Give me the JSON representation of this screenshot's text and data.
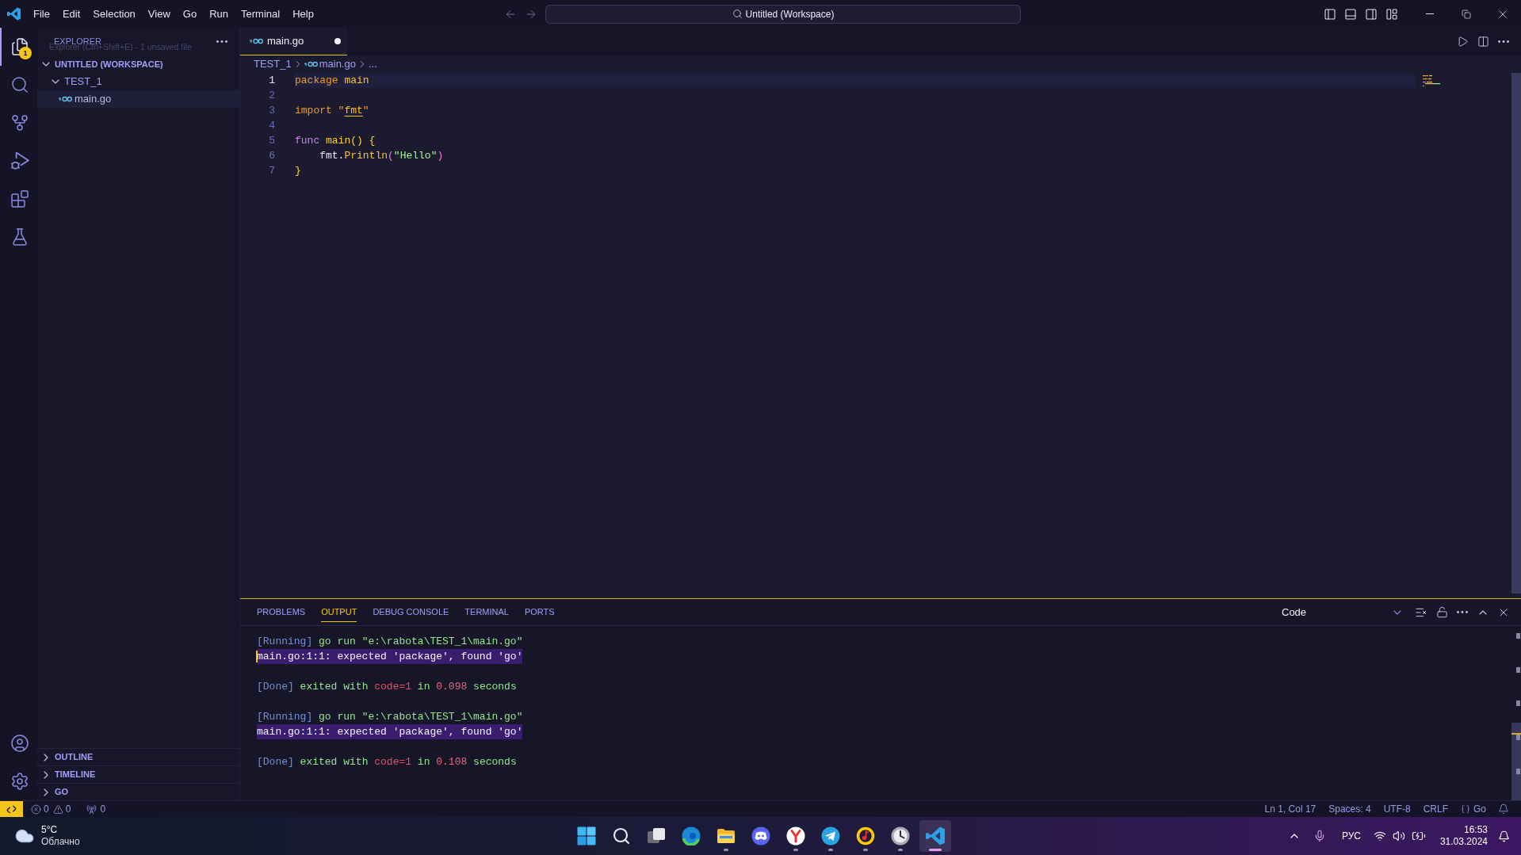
{
  "title_bar": {
    "menu": [
      "File",
      "Edit",
      "Selection",
      "View",
      "Go",
      "Run",
      "Terminal",
      "Help"
    ],
    "command_center": "Untitled (Workspace)"
  },
  "activity_bar": {
    "items": [
      {
        "kind": "explorer",
        "selected": true,
        "badge": "1"
      },
      {
        "kind": "search",
        "selected": false
      },
      {
        "kind": "source_control",
        "selected": false
      },
      {
        "kind": "run_debug",
        "selected": false
      },
      {
        "kind": "extensions",
        "selected": false
      },
      {
        "kind": "testing",
        "selected": false
      }
    ],
    "bottom_items": [
      {
        "kind": "accounts"
      },
      {
        "kind": "settings"
      }
    ]
  },
  "sidebar": {
    "title": "EXPLORER",
    "tooltip": "Explorer (Ctrl+Shift+E) - 1 unsaved file",
    "tree": [
      {
        "label": "UNTITLED (WORKSPACE)",
        "kind": "section",
        "expanded": true,
        "selected": false,
        "children": [
          {
            "label": "TEST_1",
            "kind": "folder",
            "expanded": true,
            "selected": false,
            "children": [
              {
                "label": "main.go",
                "kind": "file",
                "selected": true
              }
            ]
          }
        ]
      }
    ],
    "sections": [
      {
        "label": "OUTLINE",
        "expanded": false
      },
      {
        "label": "TIMELINE",
        "expanded": false
      },
      {
        "label": "GO",
        "expanded": false
      }
    ]
  },
  "editor": {
    "tabs": [
      {
        "label": "main.go",
        "selected": true,
        "dirty": true
      }
    ],
    "breadcrumbs": [
      {
        "label": "TEST_1",
        "kind": "folder"
      },
      {
        "label": "main.go",
        "kind": "file"
      },
      {
        "label": "...",
        "kind": "symbol"
      }
    ],
    "lines": [
      {
        "number": "1",
        "current": true,
        "tokens": [
          {
            "text": "package ",
            "kind": "keyword"
          },
          {
            "text": "main",
            "kind": "name"
          }
        ]
      },
      {
        "number": "2",
        "current": false
      },
      {
        "number": "3",
        "current": false,
        "tokens": [
          {
            "text": "import \"",
            "kind": "keyword"
          },
          {
            "text": "fmt",
            "kind": "link"
          },
          {
            "text": "\"",
            "kind": "keyword"
          }
        ]
      },
      {
        "number": "4",
        "current": false
      },
      {
        "number": "5",
        "current": false,
        "tokens": [
          {
            "text": "func ",
            "kind": "storage"
          },
          {
            "text": "main() {",
            "kind": "function"
          }
        ]
      },
      {
        "number": "6",
        "current": false,
        "tokens": [
          {
            "text": "    fmt.",
            "kind": "variable"
          },
          {
            "text": "Println",
            "kind": "method"
          },
          {
            "text": "(",
            "kind": "paren"
          },
          {
            "text": "\"Hello\"",
            "kind": "string"
          },
          {
            "text": ")",
            "kind": "paren"
          }
        ]
      },
      {
        "number": "7",
        "current": false,
        "tokens": [
          {
            "text": "}",
            "kind": "function"
          }
        ]
      }
    ]
  },
  "panel": {
    "tabs": [
      {
        "label": "PROBLEMS",
        "selected": false
      },
      {
        "label": "OUTPUT",
        "selected": true
      },
      {
        "label": "DEBUG CONSOLE",
        "selected": false
      },
      {
        "label": "TERMINAL",
        "selected": false
      },
      {
        "label": "PORTS",
        "selected": false
      }
    ],
    "output_channel": "Code",
    "output_blocks": [
      {
        "lines": [
          {
            "highlighted": false,
            "cursor": false,
            "tokens": [
              {
                "text": "[Running]",
                "kind": "tag"
              },
              {
                "text": " go run \"e:\\rabota\\TEST_1\\main.go\"",
                "kind": "text"
              }
            ]
          },
          {
            "highlighted": true,
            "cursor": true,
            "tokens": [
              {
                "text": "main.go:1:1: expected 'package', found 'go'",
                "kind": "message"
              }
            ]
          }
        ]
      },
      {
        "lines": [
          {
            "highlighted": false,
            "cursor": false,
            "tokens": [
              {
                "text": "[Done]",
                "kind": "tag"
              },
              {
                "text": " exited with ",
                "kind": "text"
              },
              {
                "text": "code=1",
                "kind": "code"
              },
              {
                "text": " in ",
                "kind": "text"
              },
              {
                "text": "0.098",
                "kind": "number"
              },
              {
                "text": " seconds",
                "kind": "text"
              }
            ]
          }
        ]
      },
      {
        "lines": [
          {
            "highlighted": false,
            "cursor": false,
            "tokens": [
              {
                "text": "[Running]",
                "kind": "tag"
              },
              {
                "text": " go run \"e:\\rabota\\TEST_1\\main.go\"",
                "kind": "text"
              }
            ]
          },
          {
            "highlighted": true,
            "cursor": false,
            "tokens": [
              {
                "text": "main.go:1:1: expected 'package', found 'go'",
                "kind": "message"
              }
            ]
          }
        ]
      },
      {
        "lines": [
          {
            "highlighted": false,
            "cursor": false,
            "tokens": [
              {
                "text": "[Done]",
                "kind": "tag"
              },
              {
                "text": " exited with ",
                "kind": "text"
              },
              {
                "text": "code=1",
                "kind": "code"
              },
              {
                "text": " in ",
                "kind": "text"
              },
              {
                "text": "0.108",
                "kind": "number"
              },
              {
                "text": " seconds",
                "kind": "text"
              }
            ]
          }
        ]
      }
    ]
  },
  "status_bar": {
    "errors": "0",
    "warnings": "0",
    "ports": "0",
    "items": [
      {
        "label": "Ln 1, Col 17",
        "kind": "plain"
      },
      {
        "label": "Spaces: 4",
        "kind": "plain"
      },
      {
        "label": "UTF-8",
        "kind": "plain"
      },
      {
        "label": "CRLF",
        "kind": "plain"
      },
      {
        "label": "Go",
        "kind": "language"
      }
    ]
  },
  "taskbar": {
    "weather": {
      "temperature": "5°C",
      "condition": "Облачно"
    },
    "apps": [
      {
        "kind": "start",
        "running": false,
        "selected": false
      },
      {
        "kind": "search",
        "running": false,
        "selected": false
      },
      {
        "kind": "task_view",
        "running": false,
        "selected": false
      },
      {
        "kind": "edge",
        "running": false,
        "selected": false
      },
      {
        "kind": "folder",
        "running": true,
        "selected": false
      },
      {
        "kind": "discord",
        "running": false,
        "selected": false
      },
      {
        "kind": "browser",
        "running": true,
        "selected": false
      },
      {
        "kind": "telegram",
        "running": true,
        "selected": false
      },
      {
        "kind": "music",
        "running": true,
        "selected": false
      },
      {
        "kind": "clock",
        "running": true,
        "selected": false
      },
      {
        "kind": "code_editor",
        "running": true,
        "selected": true
      }
    ],
    "tray": {
      "language": "РУС",
      "time": "16:53",
      "date": "31.03.2024"
    }
  }
}
